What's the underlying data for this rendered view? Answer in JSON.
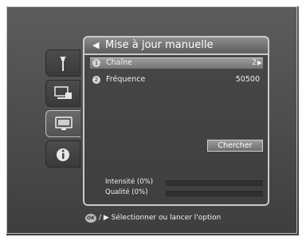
{
  "panel": {
    "title": "Mise à jour manuelle",
    "rows": [
      {
        "num": "1",
        "label": "Chaîne",
        "value": "2",
        "selected": true
      },
      {
        "num": "2",
        "label": "Fréquence",
        "value": "50500",
        "selected": false
      }
    ],
    "search_label": "Chercher",
    "meters": [
      {
        "label": "Intensité (0%)",
        "level": 0
      },
      {
        "label": "Qualité (0%)",
        "level": 0
      }
    ]
  },
  "footer": {
    "key_label": "OK",
    "text": "/  ▶ Sélectionner ou lancer l'option"
  },
  "icons": [
    "wrench-icon",
    "tv-settings-icon",
    "tv-icon",
    "info-icon"
  ]
}
